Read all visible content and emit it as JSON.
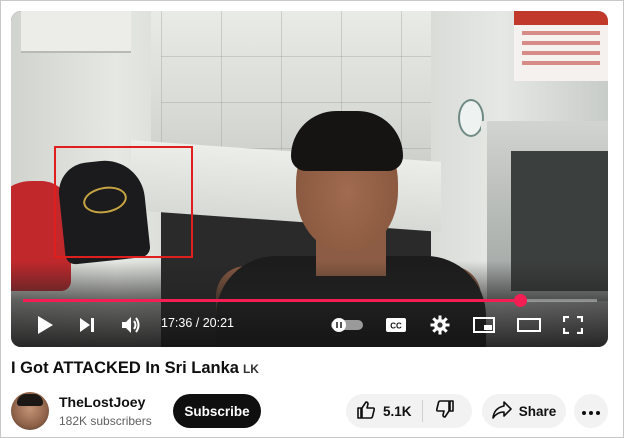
{
  "player": {
    "time_current": "17:36",
    "time_total": "20:21",
    "time_separator": " / ",
    "progress_fraction": 0.865,
    "accent_color": "#f41e54",
    "highlight_color": "#e01e1e",
    "controls": [
      {
        "name": "play-icon"
      },
      {
        "name": "next-icon"
      },
      {
        "name": "volume-icon"
      },
      {
        "name": "autoplay-toggle-icon"
      },
      {
        "name": "captions-icon"
      },
      {
        "name": "settings-gear-icon"
      },
      {
        "name": "miniplayer-icon"
      },
      {
        "name": "theater-mode-icon"
      },
      {
        "name": "fullscreen-icon"
      }
    ],
    "captions_label": "CC"
  },
  "video": {
    "title": "I Got ATTACKED In Sri Lanka",
    "flag": "LK"
  },
  "channel": {
    "name": "TheLostJoey",
    "subscribers": "182K subscribers",
    "subscribe_label": "Subscribe"
  },
  "actions": {
    "like_count": "5.1K",
    "share_label": "Share"
  }
}
